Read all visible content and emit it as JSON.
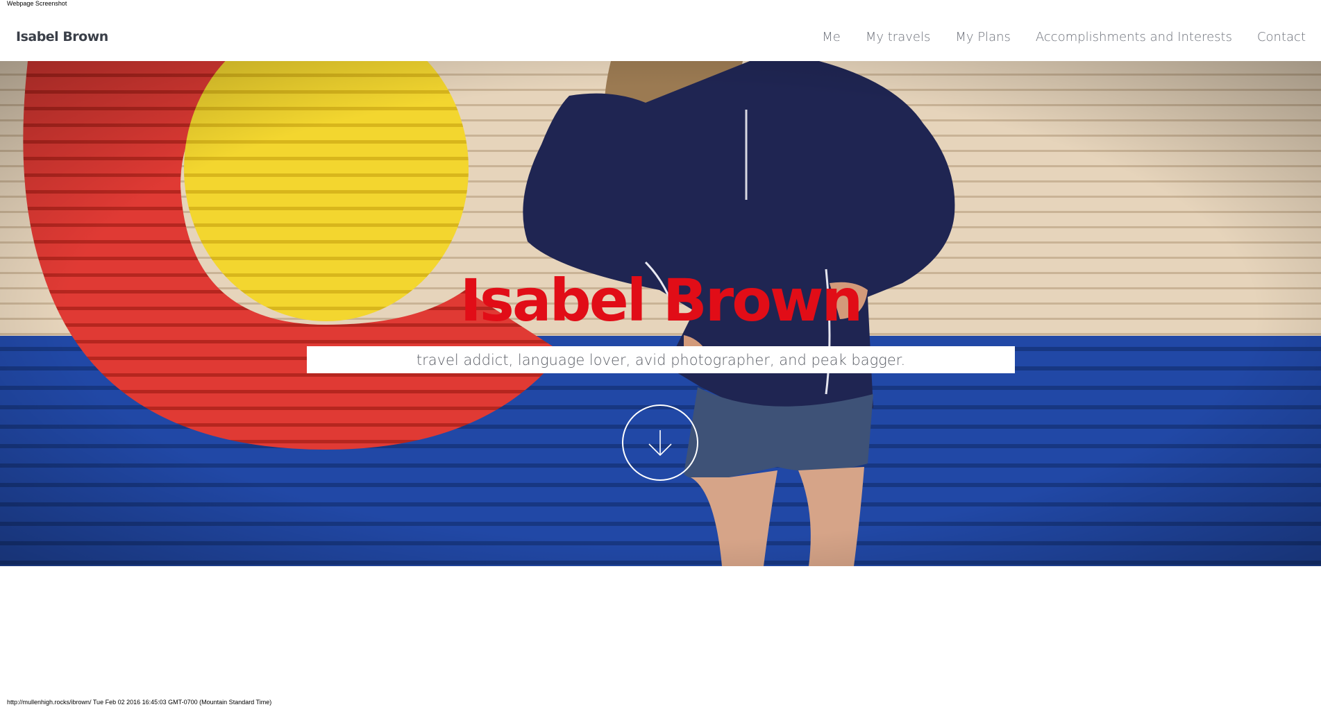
{
  "print": {
    "header": "Webpage Screenshot",
    "footer": "http://mullenhigh.rocks/ibrown/ Tue Feb 02 2016 16:45:03 GMT-0700 (Mountain Standard Time)"
  },
  "nav": {
    "brand": "Isabel Brown",
    "items": [
      {
        "label": "Me"
      },
      {
        "label": "My travels"
      },
      {
        "label": "My Plans"
      },
      {
        "label": "Accomplishments and Interests"
      },
      {
        "label": "Contact"
      }
    ]
  },
  "hero": {
    "title": "Isabel Brown",
    "tagline": "travel addict, language lover, avid photographer, and peak bagger.",
    "scroll_icon": "arrow-down-icon",
    "background": "colorado-flag-mural-photo"
  },
  "colors": {
    "title": "#e10d17",
    "nav_text": "#6b6f78",
    "brand_text": "#3a3f48",
    "flag_red": "#e23a36",
    "flag_yellow": "#f2d22c",
    "flag_blue": "#1f44a0",
    "jacket_navy": "#1e2450"
  }
}
